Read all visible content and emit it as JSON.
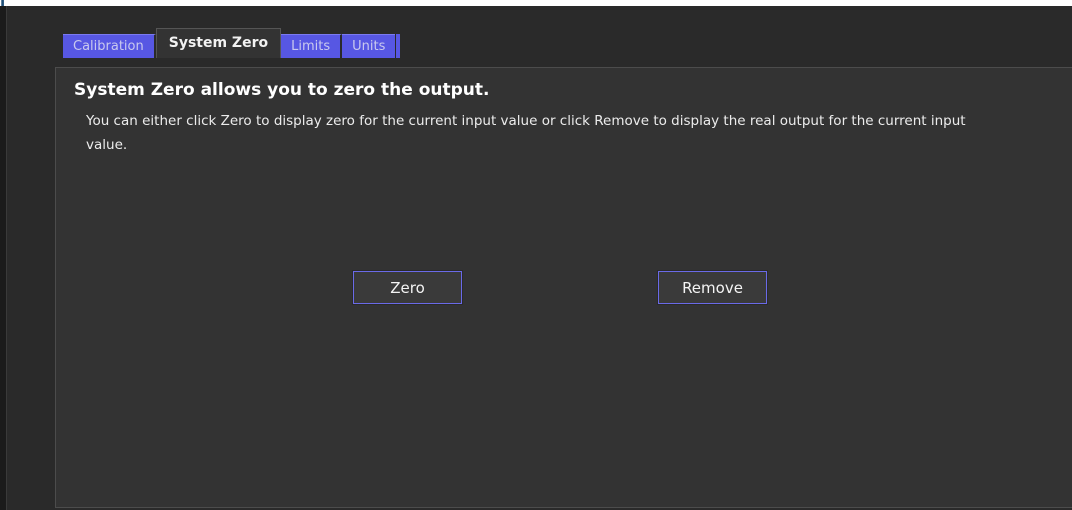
{
  "tabs": [
    {
      "label": "Calibration",
      "active": false
    },
    {
      "label": "System Zero",
      "active": true
    },
    {
      "label": "Limits",
      "active": false
    },
    {
      "label": "Units",
      "active": false
    }
  ],
  "panel": {
    "title": "System Zero allows you to zero the output.",
    "description": "You can either click Zero to display zero for the current input value or click Remove to display the real output for the current input value.",
    "zero_button": "Zero",
    "remove_button": "Remove"
  },
  "colors": {
    "background": "#2a2a2a",
    "panel": "#333333",
    "tab_inactive": "#5757e3",
    "button_border": "#6a6ae8"
  }
}
